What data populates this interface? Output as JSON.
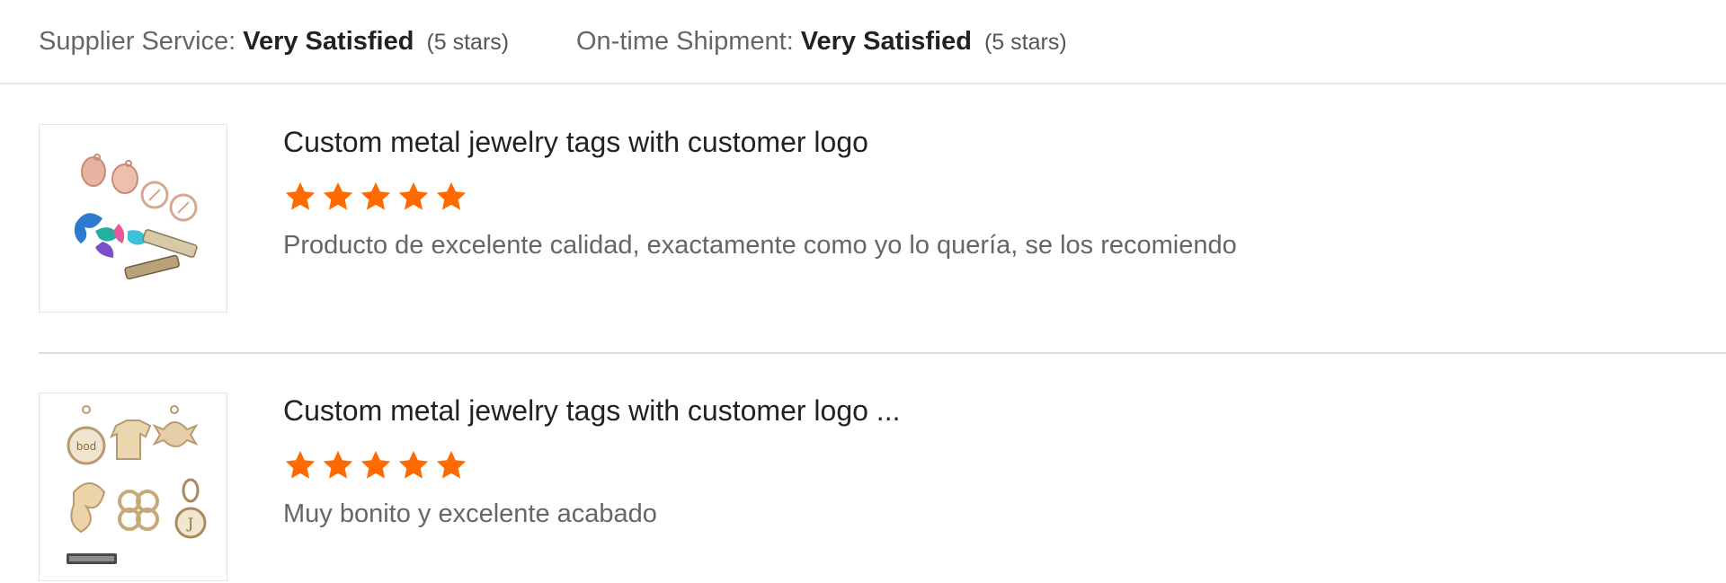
{
  "summary": {
    "supplier_service": {
      "label": "Supplier Service:",
      "value": "Very Satisfied",
      "note": "(5 stars)"
    },
    "ontime_shipment": {
      "label": "On-time Shipment:",
      "value": "Very Satisfied",
      "note": "(5 stars)"
    }
  },
  "colors": {
    "star": "#ff6a00",
    "divider": "#e6e6e6"
  },
  "reviews": [
    {
      "product_title": "Custom metal jewelry tags with customer logo",
      "rating": 5,
      "rating_max": 5,
      "comment": "Producto de excelente calidad, exactamente como yo lo quería, se los recomiendo",
      "thumbnail_icon": "jewelry-charms-image"
    },
    {
      "product_title": "Custom metal jewelry tags with customer logo ...",
      "rating": 5,
      "rating_max": 5,
      "comment": "Muy bonito y excelente acabado",
      "thumbnail_icon": "jewelry-pendants-image"
    }
  ]
}
